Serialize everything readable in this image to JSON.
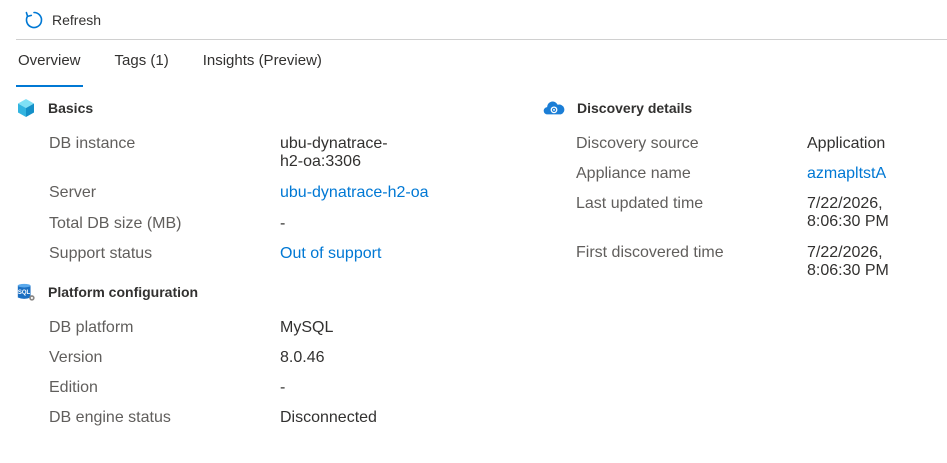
{
  "toolbar": {
    "refresh_label": "Refresh"
  },
  "tabs": [
    {
      "label": "Overview"
    },
    {
      "label": "Tags (1)"
    },
    {
      "label": "Insights (Preview)"
    }
  ],
  "basics": {
    "title": "Basics",
    "rows": [
      {
        "label": "DB instance",
        "value": "ubu-dynatrace-h2-oa:3306"
      },
      {
        "label": "Server",
        "value": "ubu-dynatrace-h2-oa"
      },
      {
        "label": "Total DB size (MB)",
        "value": "-"
      },
      {
        "label": "Support status",
        "value": "Out of support"
      }
    ]
  },
  "platform": {
    "title": "Platform configuration",
    "icon_text": "SQL",
    "rows": [
      {
        "label": "DB platform",
        "value": "MySQL"
      },
      {
        "label": "Version",
        "value": "8.0.46"
      },
      {
        "label": "Edition",
        "value": "-"
      },
      {
        "label": "DB engine status",
        "value": "Disconnected"
      }
    ]
  },
  "discovery": {
    "title": "Discovery details",
    "rows": [
      {
        "label": "Discovery source",
        "value": "Application"
      },
      {
        "label": "Appliance name",
        "value": "azmapltstA"
      },
      {
        "label": "Last updated time",
        "value": "7/22/2026, 8:06:30 PM"
      },
      {
        "label": "First discovered time",
        "value": "7/22/2026, 8:06:30 PM"
      }
    ]
  },
  "colors": {
    "accent": "#0078d4",
    "text": "#323130",
    "label": "#605e5c",
    "divider": "#d0d0d0"
  }
}
